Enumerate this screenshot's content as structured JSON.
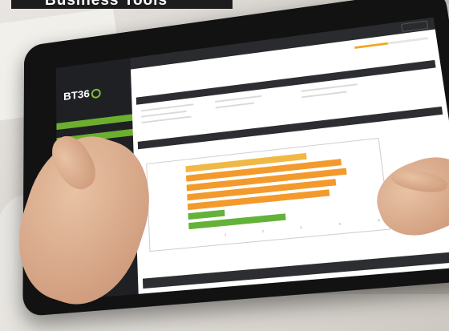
{
  "banner": {
    "title": "Business Tools"
  },
  "app": {
    "logo": "BT36",
    "breadcrumb": "",
    "page_title": "",
    "page_subtitle": ""
  },
  "sidebar": {
    "items": [
      {
        "label": ""
      },
      {
        "label": ""
      },
      {
        "label": ""
      },
      {
        "label": ""
      },
      {
        "label": ""
      },
      {
        "label": ""
      },
      {
        "label": ""
      },
      {
        "label": ""
      },
      {
        "label": ""
      },
      {
        "label": ""
      },
      {
        "label": ""
      },
      {
        "label": ""
      }
    ]
  },
  "progress": {
    "label": "",
    "value": 0.45
  },
  "sections": {
    "basis_info": "",
    "analysis": ""
  },
  "chart_data": {
    "type": "bar",
    "title": "",
    "categories": [
      "",
      "",
      "",
      "",
      "",
      "",
      ""
    ],
    "series": [
      {
        "color": "#f0b845",
        "values": [
          3.3
        ]
      },
      {
        "color": "#f39a2c",
        "values": [
          4.2,
          4.3,
          4.0,
          3.8
        ]
      },
      {
        "color": "#64b23a",
        "values": [
          1.0,
          2.6
        ]
      }
    ],
    "xlim": [
      0,
      5
    ],
    "ticks": [
      "1",
      "2",
      "3",
      "4",
      "5"
    ],
    "colors": {
      "yellow": "#f0b845",
      "orange": "#f39a2c",
      "green": "#64b23a"
    }
  }
}
